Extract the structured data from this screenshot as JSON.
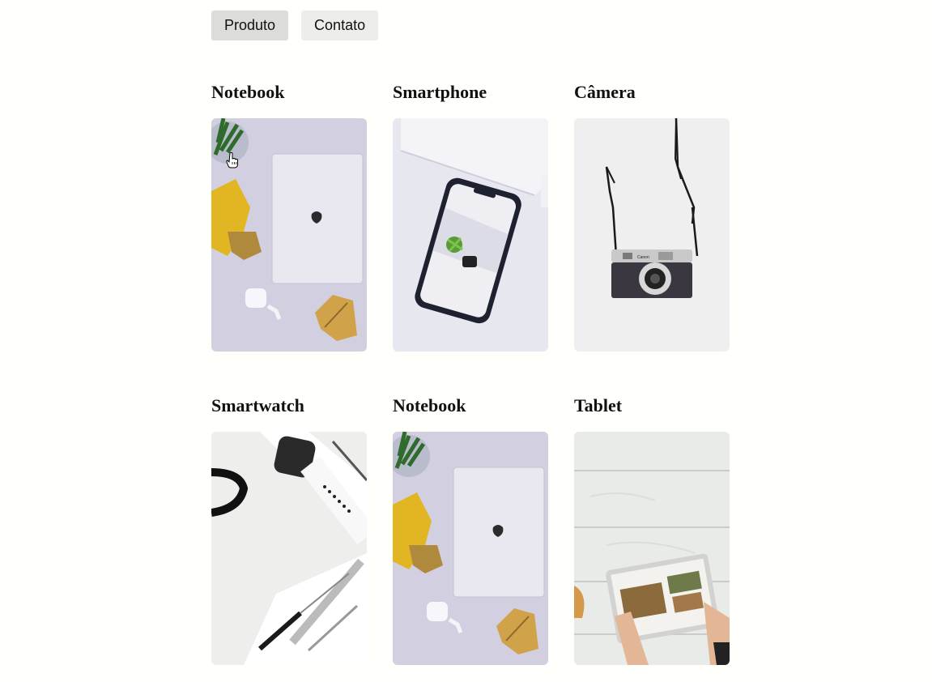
{
  "nav": {
    "items": [
      {
        "label": "Produto",
        "active": true
      },
      {
        "label": "Contato",
        "active": false
      }
    ]
  },
  "products": [
    {
      "title": "Notebook",
      "image": "notebook-photo"
    },
    {
      "title": "Smartphone",
      "image": "smartphone-photo"
    },
    {
      "title": "Câmera",
      "image": "camera-photo"
    },
    {
      "title": "Smartwatch",
      "image": "smartwatch-photo"
    },
    {
      "title": "Notebook",
      "image": "notebook-photo"
    },
    {
      "title": "Tablet",
      "image": "tablet-photo"
    }
  ],
  "camera_brand": "Canon",
  "icons": {
    "cursor": "pointer-hand-icon"
  }
}
